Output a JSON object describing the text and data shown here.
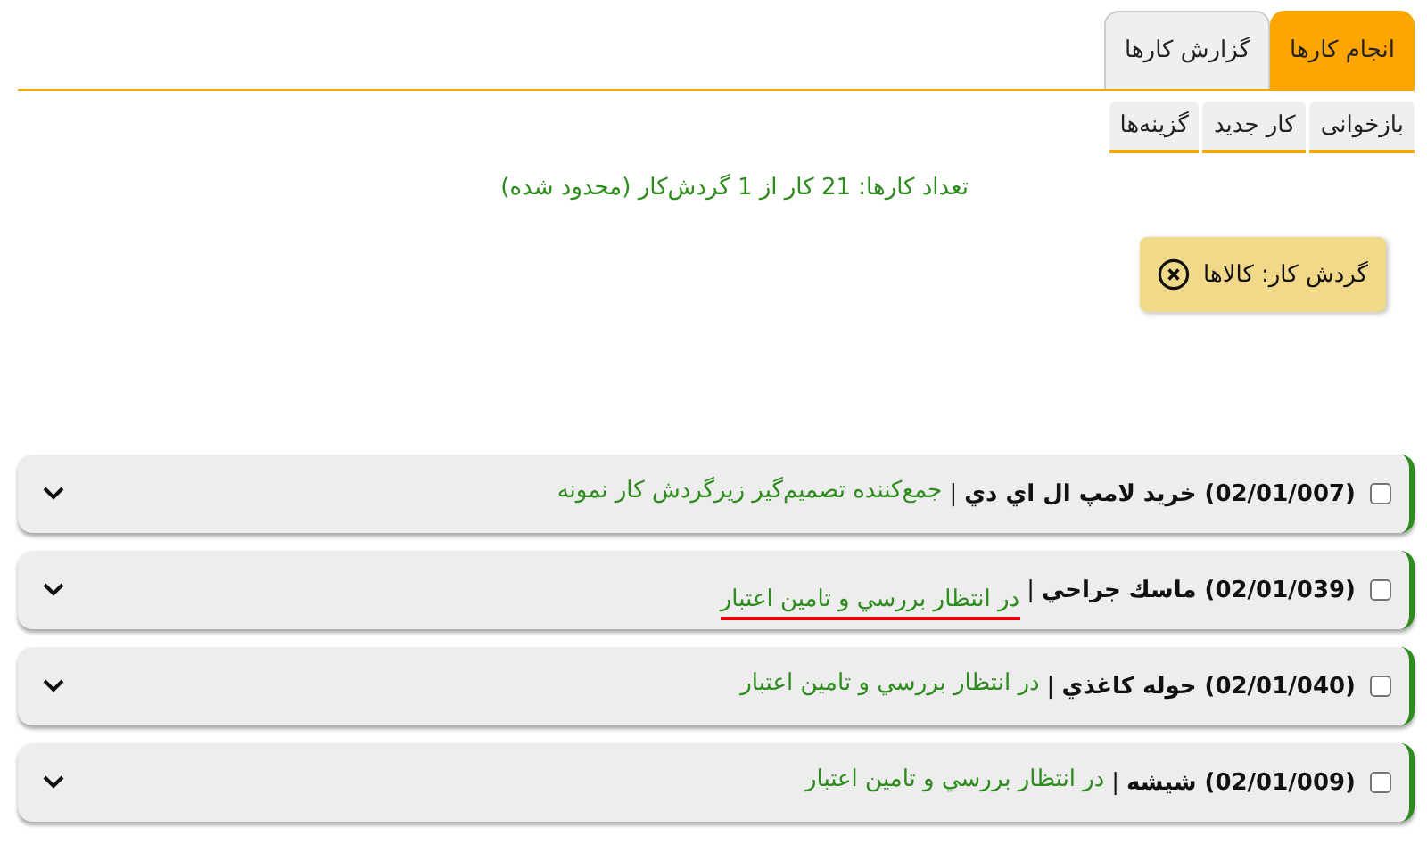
{
  "tabs": [
    {
      "label": "انجام کارها",
      "selected": true
    },
    {
      "label": "گزارش کارها",
      "selected": false
    }
  ],
  "toolbar": [
    "بازخوانی",
    "کار جدید",
    "گزینه‌ها"
  ],
  "summary": "تعداد کارها: 21 کار از 1 گردش‌کار (محدود شده)",
  "filter": {
    "label": "گردش کار: کالاها"
  },
  "tasks": [
    {
      "title": "(02/01/007) خريد لامپ ال اي دي",
      "separator": "|",
      "status": "جمع‌کننده تصميم‌گير زيرگردش کار نمونه",
      "checked": false,
      "expanded": false,
      "underlined": false
    },
    {
      "title": "(02/01/039) ماسك جراحي",
      "separator": "|",
      "status": "در انتظار بررسي و تامين اعتبار",
      "checked": false,
      "expanded": false,
      "underlined": true
    },
    {
      "title": "(02/01/040) حوله كاغذي",
      "separator": "|",
      "status": "در انتظار بررسي و تامين اعتبار",
      "checked": false,
      "expanded": false,
      "underlined": false
    },
    {
      "title": "(02/01/009) شيشه",
      "separator": "|",
      "status": "در انتظار بررسي و تامين اعتبار",
      "checked": false,
      "expanded": false,
      "underlined": false
    }
  ]
}
